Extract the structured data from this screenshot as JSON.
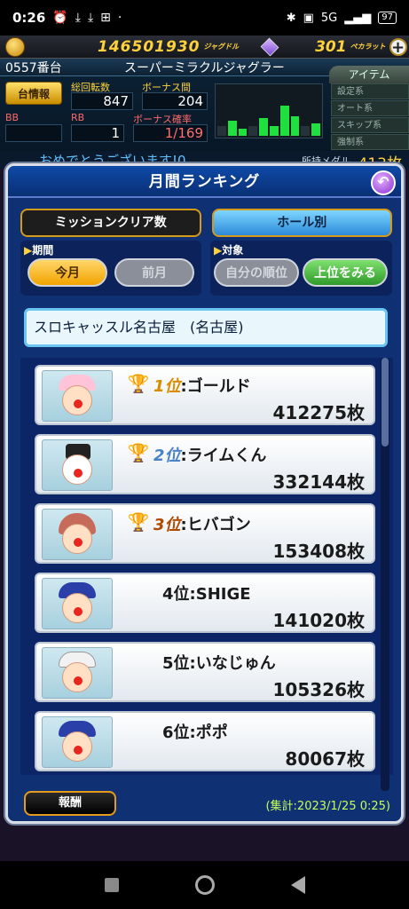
{
  "status_bar": {
    "time": "0:26",
    "right_icons": [
      "bluetooth-icon",
      "volte-icon",
      "5g-icon",
      "signal-icon",
      "battery-icon"
    ],
    "network": "5G",
    "battery": "97"
  },
  "topbar": {
    "coins": "146501930",
    "coins_unit": "ジャグドル",
    "gems": "301",
    "gems_unit": "ペカラット"
  },
  "machine": {
    "number": "0557番台",
    "name": "スーパーミラクルジャグラー",
    "info_button": "台情報",
    "total_spins_label": "総回転数",
    "total_spins": "847",
    "bonus_gap_label": "ボーナス間",
    "bonus_gap": "204",
    "bb_label": "BB",
    "bb": "",
    "rb_label": "RB",
    "rb": "1",
    "bonus_prob_label": "ボーナス確率",
    "bonus_prob": "1/169",
    "item_tab": "アイテム",
    "items": [
      "設定系",
      "オート系",
      "スキップ系",
      "強制系"
    ],
    "ticker": "おめでとうございます!0",
    "medal_label": "所持メダル",
    "medal_value": "413枚"
  },
  "dialog": {
    "title": "月間ランキング",
    "tabs": [
      {
        "label": "ミッションクリア数",
        "active": false
      },
      {
        "label": "ホール別",
        "active": true
      }
    ],
    "period_label": "期間",
    "period_options": [
      "今月",
      "前月"
    ],
    "target_label": "対象",
    "target_options": [
      "自分の順位",
      "上位をみる"
    ],
    "hall_name": "スロキャッスル名古屋　(名古屋)",
    "rankings": [
      {
        "rank": "1位",
        "name": ":ゴールド",
        "score": "412275枚"
      },
      {
        "rank": "2位",
        "name": ":ライムくん",
        "score": "332144枚"
      },
      {
        "rank": "3位",
        "name": ":ヒバゴン",
        "score": "153408枚"
      },
      {
        "rank": "4位",
        "name": ":SHIGE",
        "score": "141020枚"
      },
      {
        "rank": "5位",
        "name": ":いなじゅん",
        "score": "105326枚"
      },
      {
        "rank": "6位",
        "name": ":ポポ",
        "score": "80067枚"
      }
    ],
    "reward_button": "報酬",
    "aggregated_at": "(集計:2023/1/25 0:25)"
  },
  "colors": {
    "dialog_bg": "#103074",
    "accent_gold": "#ffd23c",
    "tab_active": "#2b8ad8",
    "hall_border": "#6ac6ef"
  }
}
